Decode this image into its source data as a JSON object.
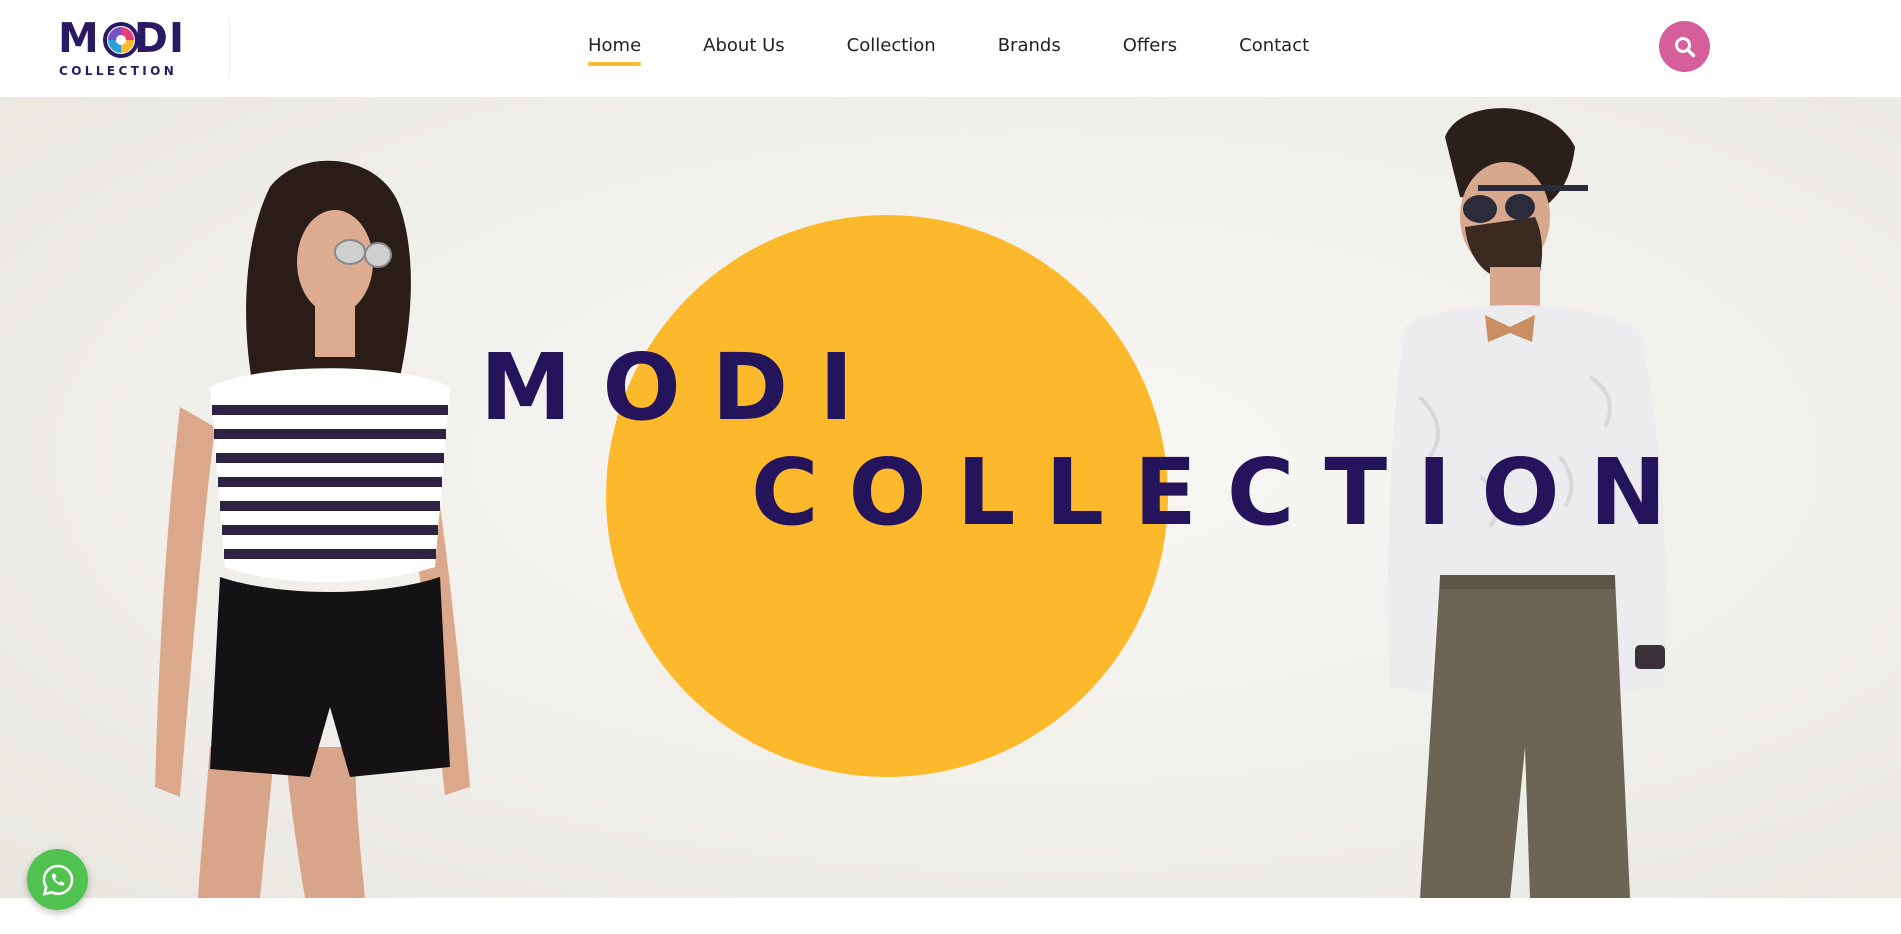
{
  "brand": {
    "logo_main": "MODI",
    "logo_sub": "COLLECTION",
    "colors": {
      "navy": "#23145c",
      "accent_yellow": "#fdb92c",
      "search_pink": "#d65e9b",
      "whatsapp_green": "#4fc24f"
    }
  },
  "nav": {
    "items": [
      {
        "label": "Home",
        "active": true
      },
      {
        "label": "About Us",
        "active": false
      },
      {
        "label": "Collection",
        "active": false
      },
      {
        "label": "Brands",
        "active": false
      },
      {
        "label": "Offers",
        "active": false
      },
      {
        "label": "Contact",
        "active": false
      }
    ]
  },
  "search": {
    "icon": "search-icon"
  },
  "hero": {
    "title_line1": "MODI",
    "title_line2": "COLLECTION"
  },
  "whatsapp": {
    "icon": "whatsapp-icon"
  }
}
